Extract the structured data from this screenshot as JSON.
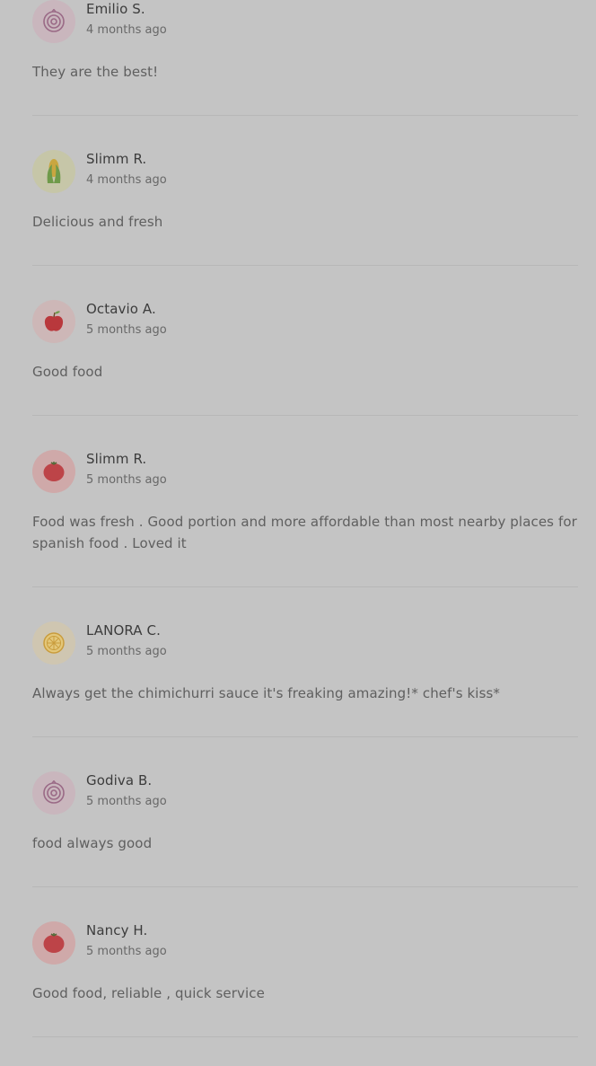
{
  "reviews": [
    {
      "name": "Emilio S.",
      "time": "4 months ago",
      "text": "They are the best!",
      "avatar_icon": "onion-icon",
      "avatar_bg": "#c9b6bd"
    },
    {
      "name": "Slimm R.",
      "time": "4 months ago",
      "text": "Delicious and fresh",
      "avatar_icon": "corn-icon",
      "avatar_bg": "#c6c6a8"
    },
    {
      "name": "Octavio A.",
      "time": "5 months ago",
      "text": "Good food",
      "avatar_icon": "apple-icon",
      "avatar_bg": "#cdb7b7"
    },
    {
      "name": "Slimm R.",
      "time": "5 months ago",
      "text": "Food was fresh . Good portion and more affordable than most nearby places for spanish food . Loved it",
      "avatar_icon": "tomato-icon",
      "avatar_bg": "#cfa9a9"
    },
    {
      "name": "LANORA C.",
      "time": "5 months ago",
      "text": "Always get the chimichurri sauce it's freaking amazing!* chef's kiss*",
      "avatar_icon": "lemon-icon",
      "avatar_bg": "#cfc6b1"
    },
    {
      "name": "Godiva B.",
      "time": "5 months ago",
      "text": "food always good",
      "avatar_icon": "onion-icon",
      "avatar_bg": "#c9b6bd"
    },
    {
      "name": "Nancy H.",
      "time": "5 months ago",
      "text": "Good food, reliable , quick service",
      "avatar_icon": "tomato-icon",
      "avatar_bg": "#cfa9a9"
    }
  ]
}
